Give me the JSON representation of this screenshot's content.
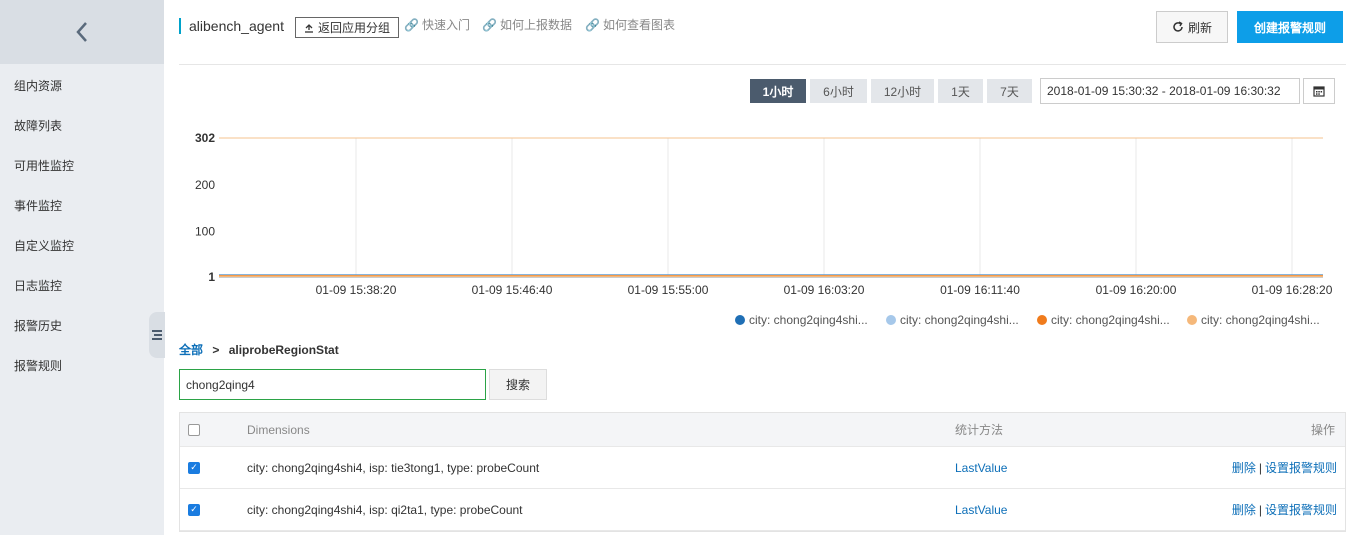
{
  "sidebar": {
    "items": [
      {
        "label": "组内资源"
      },
      {
        "label": "故障列表"
      },
      {
        "label": "可用性监控"
      },
      {
        "label": "事件监控"
      },
      {
        "label": "自定义监控"
      },
      {
        "label": "日志监控"
      },
      {
        "label": "报警历史"
      },
      {
        "label": "报警规则"
      }
    ]
  },
  "header": {
    "app_name": "alibench_agent",
    "back_button": "返回应用分组",
    "links": [
      "快速入门",
      "如何上报数据",
      "如何查看图表"
    ],
    "refresh_button": "刷新",
    "create_button": "创建报警规则"
  },
  "time_filter": {
    "options": [
      "1小时",
      "6小时",
      "12小时",
      "1天",
      "7天"
    ],
    "active": "1小时",
    "range": "2018-01-09 15:30:32 - 2018-01-09 16:30:32"
  },
  "chart_data": {
    "type": "line",
    "x": [
      "01-09 15:38:20",
      "01-09 15:46:40",
      "01-09 15:55:00",
      "01-09 16:03:20",
      "01-09 16:11:40",
      "01-09 16:20:00",
      "01-09 16:28:20"
    ],
    "y_ticks": [
      "302",
      "200",
      "100",
      "1"
    ],
    "ylim": [
      1,
      302
    ],
    "grid": true,
    "legend_position": "bottom-right",
    "series": [
      {
        "name": "city: chong2qing4shi...",
        "color": "#1f6fb5",
        "values": [
          1,
          1,
          1,
          1,
          1,
          1,
          1
        ]
      },
      {
        "name": "city: chong2qing4shi...",
        "color": "#a6c8ea",
        "values": [
          1,
          1,
          1,
          1,
          1,
          1,
          1
        ]
      },
      {
        "name": "city: chong2qing4shi...",
        "color": "#f07b1c",
        "values": [
          1,
          1,
          1,
          1,
          1,
          1,
          1
        ]
      },
      {
        "name": "city: chong2qing4shi...",
        "color": "#f5b87a",
        "values": [
          1,
          1,
          1,
          1,
          1,
          1,
          1
        ]
      }
    ],
    "max_line_value": 302,
    "max_line_color": "#f5c38f"
  },
  "breadcrumb": {
    "root": "全部",
    "separator": ">",
    "current": "aliprobeRegionStat"
  },
  "search": {
    "value": "chong2qing4",
    "button": "搜索"
  },
  "table": {
    "headers": {
      "dimensions": "Dimensions",
      "method": "统计方法",
      "actions": "操作"
    },
    "rows": [
      {
        "dimensions": "city: chong2qing4shi4, isp: tie3tong1, type: probeCount",
        "method": "LastValue",
        "delete": "删除",
        "separator": "|",
        "set_rule": "设置报警规则",
        "checked": true
      },
      {
        "dimensions": "city: chong2qing4shi4, isp: qi2ta1, type: probeCount",
        "method": "LastValue",
        "delete": "删除",
        "separator": "|",
        "set_rule": "设置报警规则",
        "checked": true
      }
    ]
  }
}
